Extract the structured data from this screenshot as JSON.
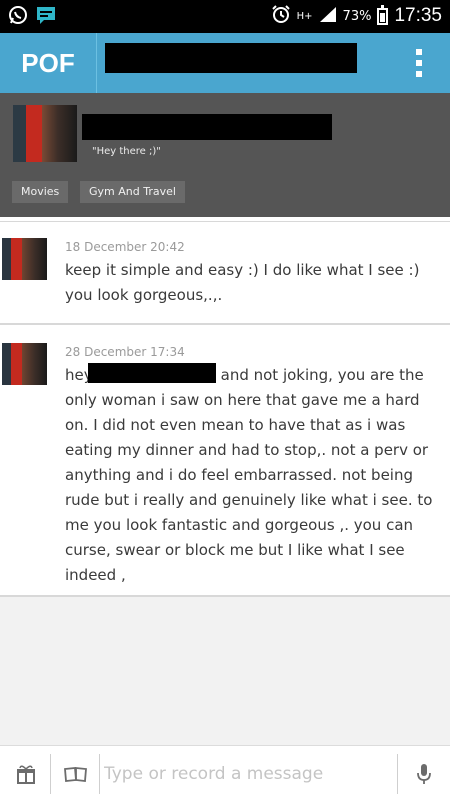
{
  "status_bar": {
    "battery": "73%",
    "time": "17:35",
    "network": "H+",
    "icons": [
      "whatsapp-icon",
      "chat-icon",
      "alarm-icon",
      "signal-icon",
      "battery-icon"
    ]
  },
  "header": {
    "logo": "POF",
    "menu_icon": "overflow-menu-icon"
  },
  "profile": {
    "status": "\"Hey there ;)\"",
    "tags": [
      "Movies",
      "Gym And Travel"
    ]
  },
  "messages": [
    {
      "date": "18 December 20:42",
      "text": "keep it simple and easy :) I do like what I see :) you look gorgeous,.,."
    },
    {
      "date": "28 December 17:34",
      "text": "hey                    ,. will be honest and not joking, you are the only woman i saw on here that gave me a hard on. I did not even mean to have that as i was eating my dinner and had to stop,. not a perv or anything and i do feel embarrassed. not being rude but i really and genuinely like what i see. to me you look fantastic and gorgeous ,. you can curse, swear or block me but I like what I see indeed ,"
    }
  ],
  "composer": {
    "placeholder": "Type or record a message",
    "value": "",
    "buttons": [
      "gift-icon",
      "card-icon",
      "microphone-icon"
    ]
  },
  "colors": {
    "appbar": "#4aa6cf",
    "profile_bg": "#555555",
    "text": "#3a3a3a",
    "date": "#9a9a9a"
  }
}
